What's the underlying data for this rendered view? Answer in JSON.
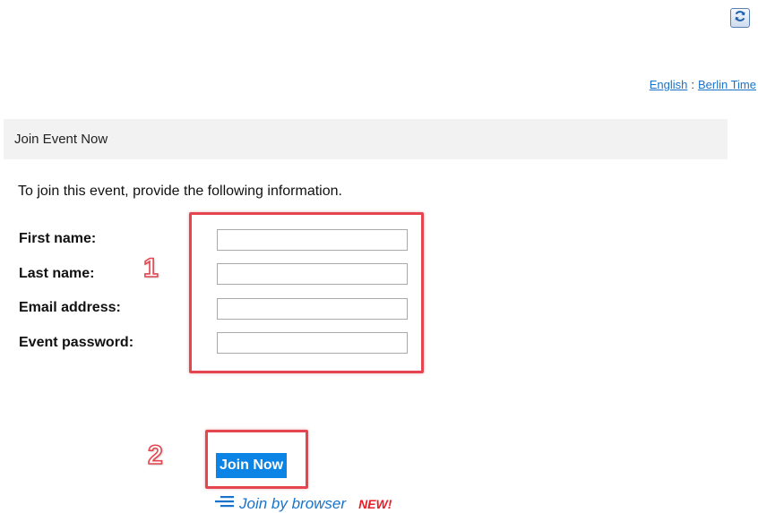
{
  "toolbar": {
    "refresh_icon": "refresh-icon"
  },
  "topbar": {
    "language_link": "English",
    "separator": ":",
    "timezone_link": "Berlin Time"
  },
  "section": {
    "title": "Join Event Now"
  },
  "form": {
    "instructions": "To join this event, provide the following information.",
    "fields": [
      {
        "label": "First name:",
        "value": "",
        "placeholder": ""
      },
      {
        "label": "Last name:",
        "value": "",
        "placeholder": ""
      },
      {
        "label": "Email address:",
        "value": "",
        "placeholder": ""
      },
      {
        "label": "Event password:",
        "value": "",
        "placeholder": ""
      }
    ]
  },
  "annotations": {
    "step1": "1",
    "step2": "2",
    "highlight_color": "#e4454f"
  },
  "actions": {
    "join_now_label": "Join Now",
    "join_browser_label": "Join by browser",
    "new_badge": "NEW!",
    "join_browser_icon": "menu-lines-icon",
    "accent_color": "#0b84e6"
  }
}
